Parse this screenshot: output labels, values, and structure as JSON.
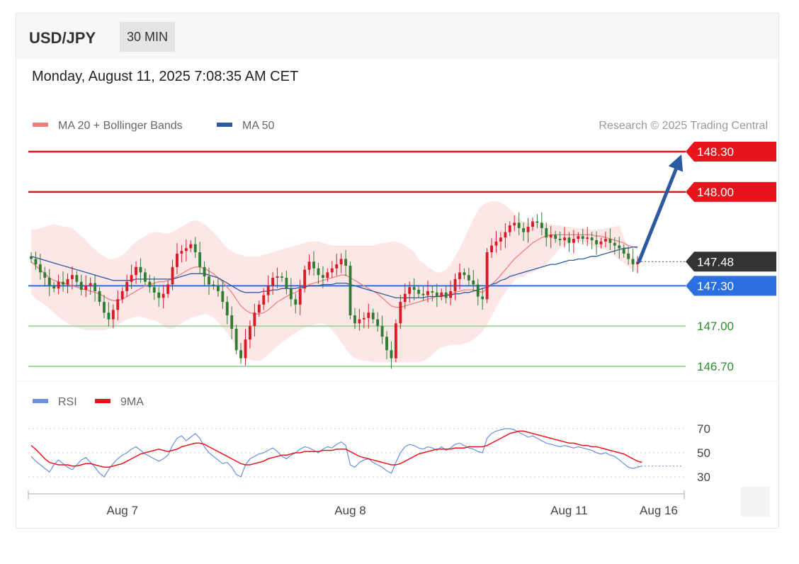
{
  "header": {
    "symbol": "USD/JPY",
    "timeframe": "30 MIN"
  },
  "datetime": "Monday, August 11, 2025 7:08:35 AM CET",
  "legend": {
    "ma20_label": "MA 20 + Bollinger Bands",
    "ma50_label": "MA 50",
    "rsi_label": "RSI",
    "ma9_label": "9MA",
    "credit": "Research © 2025 Trading Central"
  },
  "colors": {
    "red_level": "#e8141c",
    "blue_level": "#2b6fe0",
    "green_level": "#a9d6a5",
    "green_text": "#2e8b2e",
    "ma20": "#f08080",
    "ma50": "#2c5aa0",
    "band": "#fde3e3",
    "rsi": "#6a8fe0",
    "ma9": "#e8141c",
    "candle_up": "#d81b27",
    "candle_down": "#2e7d32",
    "arrow": "#2c5aa0"
  },
  "chart_data": [
    {
      "type": "candlestick",
      "y_range": [
        146.65,
        148.4
      ],
      "levels": [
        {
          "value": 148.3,
          "label": "148.30",
          "style": "resistance"
        },
        {
          "value": 148.0,
          "label": "148.00",
          "style": "resistance"
        },
        {
          "value": 147.48,
          "label": "147.48",
          "style": "current"
        },
        {
          "value": 147.3,
          "label": "147.30",
          "style": "pivot"
        },
        {
          "value": 147.0,
          "label": "147.00",
          "style": "support"
        },
        {
          "value": 146.7,
          "label": "146.70",
          "style": "support"
        }
      ],
      "x_tick_labels": [
        "Aug 7",
        "Aug 8",
        "Aug 11",
        "Aug 16"
      ],
      "x_tick_index": [
        20,
        70,
        118,
        138
      ],
      "bar_count": 134,
      "closes": [
        147.5,
        147.46,
        147.4,
        147.36,
        147.3,
        147.28,
        147.33,
        147.31,
        147.35,
        147.38,
        147.33,
        147.27,
        147.3,
        147.32,
        147.26,
        147.18,
        147.1,
        147.05,
        147.12,
        147.2,
        147.26,
        147.33,
        147.38,
        147.44,
        147.4,
        147.33,
        147.29,
        147.25,
        147.21,
        147.24,
        147.31,
        147.44,
        147.54,
        147.56,
        147.58,
        147.61,
        147.55,
        147.44,
        147.37,
        147.31,
        147.3,
        147.26,
        147.18,
        147.08,
        146.98,
        146.82,
        146.76,
        146.9,
        147.0,
        147.1,
        147.16,
        147.23,
        147.3,
        147.36,
        147.37,
        147.36,
        147.28,
        147.2,
        147.16,
        147.28,
        147.42,
        147.48,
        147.43,
        147.38,
        147.36,
        147.4,
        147.43,
        147.46,
        147.5,
        147.45,
        147.08,
        147.02,
        147.05,
        147.06,
        147.1,
        147.05,
        147.0,
        146.92,
        146.82,
        146.76,
        147.02,
        147.18,
        147.24,
        147.29,
        147.27,
        147.24,
        147.23,
        147.26,
        147.25,
        147.22,
        147.25,
        147.21,
        147.26,
        147.35,
        147.4,
        147.38,
        147.34,
        147.31,
        147.22,
        147.2,
        147.55,
        147.6,
        147.63,
        147.66,
        147.7,
        147.75,
        147.77,
        147.73,
        147.7,
        147.74,
        147.78,
        147.77,
        147.73,
        147.66,
        147.68,
        147.65,
        147.64,
        147.66,
        147.62,
        147.65,
        147.67,
        147.65,
        147.66,
        147.64,
        147.61,
        147.63,
        147.65,
        147.62,
        147.6,
        147.58,
        147.54,
        147.5,
        147.46,
        147.48
      ],
      "ma20": [
        147.48,
        147.45,
        147.42,
        147.39,
        147.36,
        147.34,
        147.33,
        147.32,
        147.31,
        147.3,
        147.29,
        147.28,
        147.27,
        147.26,
        147.25,
        147.24,
        147.22,
        147.2,
        147.19,
        147.19,
        147.2,
        147.22,
        147.24,
        147.26,
        147.28,
        147.3,
        147.31,
        147.32,
        147.33,
        147.33,
        147.34,
        147.35,
        147.37,
        147.39,
        147.41,
        147.43,
        147.44,
        147.44,
        147.43,
        147.41,
        147.39,
        147.36,
        147.33,
        147.29,
        147.25,
        147.2,
        147.15,
        147.12,
        147.1,
        147.09,
        147.09,
        147.1,
        147.12,
        147.15,
        147.18,
        147.2,
        147.22,
        147.24,
        147.25,
        147.27,
        147.29,
        147.31,
        147.32,
        147.33,
        147.34,
        147.35,
        147.36,
        147.37,
        147.38,
        147.38,
        147.36,
        147.34,
        147.32,
        147.3,
        147.28,
        147.26,
        147.24,
        147.21,
        147.18,
        147.15,
        147.14,
        147.14,
        147.15,
        147.16,
        147.17,
        147.18,
        147.19,
        147.2,
        147.21,
        147.22,
        147.23,
        147.23,
        147.24,
        147.25,
        147.26,
        147.27,
        147.27,
        147.27,
        147.26,
        147.25,
        147.28,
        147.31,
        147.34,
        147.38,
        147.42,
        147.46,
        147.5,
        147.53,
        147.56,
        147.59,
        147.62,
        147.64,
        147.66,
        147.67,
        147.68,
        147.68,
        147.68,
        147.68,
        147.68,
        147.68,
        147.68,
        147.68,
        147.68,
        147.68,
        147.67,
        147.67,
        147.66,
        147.65,
        147.64,
        147.63,
        147.62,
        147.6,
        147.59,
        147.58
      ],
      "ma50": [
        147.52,
        147.51,
        147.5,
        147.49,
        147.48,
        147.47,
        147.46,
        147.45,
        147.44,
        147.43,
        147.42,
        147.41,
        147.4,
        147.39,
        147.38,
        147.37,
        147.36,
        147.35,
        147.34,
        147.34,
        147.34,
        147.34,
        147.34,
        147.35,
        147.35,
        147.35,
        147.35,
        147.35,
        147.35,
        147.35,
        147.35,
        147.35,
        147.36,
        147.37,
        147.38,
        147.39,
        147.39,
        147.39,
        147.39,
        147.38,
        147.37,
        147.36,
        147.34,
        147.32,
        147.3,
        147.28,
        147.26,
        147.25,
        147.25,
        147.25,
        147.25,
        147.26,
        147.26,
        147.27,
        147.27,
        147.28,
        147.28,
        147.28,
        147.28,
        147.29,
        147.29,
        147.3,
        147.3,
        147.3,
        147.31,
        147.31,
        147.31,
        147.32,
        147.32,
        147.32,
        147.31,
        147.3,
        147.29,
        147.28,
        147.27,
        147.26,
        147.25,
        147.24,
        147.23,
        147.22,
        147.21,
        147.21,
        147.21,
        147.21,
        147.21,
        147.21,
        147.21,
        147.22,
        147.22,
        147.22,
        147.22,
        147.23,
        147.23,
        147.24,
        147.24,
        147.25,
        147.25,
        147.26,
        147.27,
        147.28,
        147.29,
        147.31,
        147.32,
        147.34,
        147.35,
        147.37,
        147.38,
        147.39,
        147.4,
        147.41,
        147.42,
        147.43,
        147.44,
        147.45,
        147.46,
        147.46,
        147.47,
        147.48,
        147.49,
        147.49,
        147.5,
        147.5,
        147.51,
        147.52,
        147.52,
        147.53,
        147.54,
        147.55,
        147.56,
        147.57,
        147.58,
        147.58,
        147.59,
        147.59
      ],
      "band_upper": [
        147.72,
        147.72,
        147.73,
        147.74,
        147.75,
        147.76,
        147.75,
        147.74,
        147.74,
        147.73,
        147.7,
        147.67,
        147.64,
        147.6,
        147.57,
        147.54,
        147.52,
        147.5,
        147.5,
        147.51,
        147.53,
        147.56,
        147.6,
        147.63,
        147.65,
        147.67,
        147.69,
        147.7,
        147.7,
        147.69,
        147.69,
        147.7,
        147.72,
        147.74,
        147.76,
        147.78,
        147.79,
        147.78,
        147.76,
        147.73,
        147.7,
        147.66,
        147.62,
        147.58,
        147.56,
        147.54,
        147.53,
        147.52,
        147.52,
        147.52,
        147.52,
        147.53,
        147.54,
        147.55,
        147.56,
        147.57,
        147.58,
        147.59,
        147.6,
        147.61,
        147.62,
        147.63,
        147.63,
        147.63,
        147.62,
        147.61,
        147.6,
        147.6,
        147.6,
        147.6,
        147.6,
        147.6,
        147.6,
        147.6,
        147.6,
        147.6,
        147.61,
        147.62,
        147.62,
        147.63,
        147.63,
        147.62,
        147.6,
        147.58,
        147.55,
        147.5,
        147.47,
        147.44,
        147.42,
        147.4,
        147.4,
        147.42,
        147.46,
        147.52,
        147.58,
        147.65,
        147.73,
        147.8,
        147.86,
        147.9,
        147.92,
        147.93,
        147.93,
        147.92,
        147.9,
        147.87,
        147.84,
        147.8,
        147.78,
        147.77,
        147.77,
        147.77,
        147.77,
        147.76,
        147.76,
        147.75,
        147.75,
        147.74,
        147.74,
        147.73,
        147.73,
        147.73,
        147.72,
        147.72,
        147.72,
        147.72,
        147.73,
        147.73,
        147.74,
        147.75
      ],
      "band_lower": [
        147.24,
        147.2,
        147.18,
        147.16,
        147.13,
        147.1,
        147.07,
        147.04,
        147.02,
        147.0,
        146.99,
        146.98,
        146.97,
        146.97,
        146.97,
        146.97,
        146.97,
        146.98,
        146.99,
        147.01,
        147.03,
        147.05,
        147.06,
        147.07,
        147.07,
        147.06,
        147.05,
        147.04,
        147.03,
        147.0,
        146.98,
        146.98,
        147.0,
        147.02,
        147.04,
        147.06,
        147.07,
        147.08,
        147.09,
        147.08,
        147.06,
        147.03,
        146.99,
        146.95,
        146.9,
        146.85,
        146.8,
        146.77,
        146.75,
        146.74,
        146.74,
        146.76,
        146.79,
        146.82,
        146.85,
        146.88,
        146.9,
        146.93,
        146.95,
        146.97,
        146.99,
        147.0,
        147.01,
        147.02,
        147.02,
        147.0,
        146.97,
        146.93,
        146.88,
        146.83,
        146.79,
        146.76,
        146.75,
        146.74,
        146.74,
        146.73,
        146.73,
        146.73,
        146.73,
        146.73,
        146.73,
        146.73,
        146.73,
        146.73,
        146.73,
        146.73,
        146.74,
        146.76,
        146.79,
        146.82,
        146.84,
        146.85,
        146.86,
        146.86,
        146.86,
        146.87,
        146.88,
        146.9,
        146.93,
        146.96,
        147.01,
        147.07,
        147.14,
        147.2,
        147.25,
        147.3,
        147.34,
        147.36,
        147.37,
        147.39,
        147.4,
        147.42,
        147.44,
        147.46,
        147.5,
        147.54,
        147.58,
        147.6,
        147.62,
        147.63,
        147.63,
        147.63,
        147.62,
        147.6,
        147.59,
        147.58,
        147.57,
        147.55,
        147.52,
        147.49,
        147.47,
        147.44,
        147.42,
        147.4
      ],
      "projection": {
        "from": 147.48,
        "to": 148.3
      }
    },
    {
      "type": "line",
      "name": "RSI",
      "y_range": [
        25,
        80
      ],
      "y_ticks": [
        70,
        50,
        30
      ],
      "rsi": [
        47,
        43,
        40,
        37,
        34,
        40,
        44,
        41,
        38,
        36,
        40,
        44,
        46,
        42,
        38,
        33,
        30,
        36,
        41,
        45,
        48,
        50,
        53,
        55,
        52,
        49,
        47,
        45,
        43,
        45,
        48,
        56,
        62,
        64,
        60,
        63,
        66,
        62,
        55,
        50,
        47,
        44,
        41,
        42,
        38,
        32,
        30,
        40,
        45,
        47,
        49,
        50,
        52,
        54,
        51,
        47,
        45,
        48,
        50,
        53,
        55,
        54,
        52,
        50,
        53,
        55,
        54,
        57,
        59,
        56,
        40,
        38,
        42,
        44,
        45,
        42,
        40,
        38,
        35,
        33,
        42,
        50,
        55,
        57,
        56,
        54,
        53,
        55,
        54,
        52,
        55,
        52,
        54,
        57,
        58,
        56,
        54,
        53,
        51,
        50,
        62,
        66,
        68,
        69,
        70,
        70,
        69,
        67,
        65,
        63,
        64,
        62,
        60,
        58,
        57,
        56,
        55,
        56,
        55,
        54,
        55,
        54,
        53,
        52,
        50,
        49,
        50,
        48,
        47,
        44,
        41,
        38,
        37,
        38,
        39
      ],
      "ma9": [
        56,
        53,
        49,
        45,
        42,
        41,
        40,
        40,
        40,
        39,
        39,
        40,
        41,
        41,
        40,
        39,
        38,
        38,
        39,
        40,
        41,
        43,
        45,
        47,
        49,
        50,
        51,
        52,
        53,
        52,
        51,
        52,
        53,
        55,
        56,
        57,
        58,
        58,
        57,
        55,
        53,
        51,
        49,
        47,
        45,
        43,
        41,
        40,
        40,
        41,
        42,
        43,
        45,
        46,
        47,
        48,
        48,
        49,
        50,
        50,
        51,
        51,
        51,
        51,
        52,
        52,
        52,
        53,
        53,
        53,
        51,
        49,
        47,
        46,
        45,
        44,
        43,
        42,
        41,
        40,
        40,
        41,
        43,
        45,
        47,
        49,
        50,
        51,
        52,
        53,
        53,
        53,
        53,
        54,
        54,
        54,
        55,
        55,
        55,
        55,
        56,
        58,
        60,
        62,
        64,
        66,
        67,
        68,
        68,
        67,
        66,
        65,
        64,
        63,
        62,
        61,
        60,
        59,
        58,
        58,
        57,
        56,
        56,
        55,
        55,
        54,
        53,
        52,
        51,
        50,
        49,
        47,
        45,
        43,
        42
      ]
    }
  ]
}
